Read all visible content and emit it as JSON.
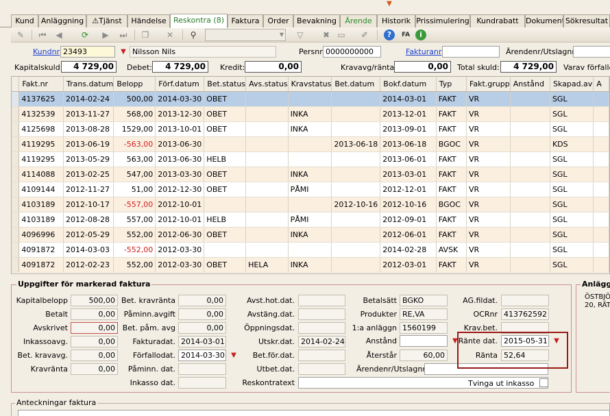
{
  "tabs": [
    "Kund",
    "Anläggning",
    "Tjänst",
    "Händelse",
    "Reskontra (8)",
    "Faktura",
    "Order",
    "Bevakning",
    "Ärende",
    "Historik",
    "Prissimulering",
    "Kundrabatt",
    "Dokument",
    "Sökresultat"
  ],
  "header": {
    "kundnr_label": "Kundnr",
    "kundnr": "23493",
    "name": "Nilsson Nils",
    "persnr_label": "Persnr",
    "persnr": "0000000000",
    "fakturanr_label": "Fakturanr",
    "fakturanr": "",
    "arendenr_label": "Ärendenr/Utslagnr",
    "arendenr": ""
  },
  "summary": {
    "kapitalskuld_label": "Kapitalskuld:",
    "kapitalskuld": "4 729,00",
    "debet_label": "Debet:",
    "debet": "4 729,00",
    "kredit_label": "Kredit:",
    "kredit": "0,00",
    "kravavg_label": "Kravavg/ränta:",
    "kravavg": "0,00",
    "total_label": "Total skuld:",
    "total": "4 729,00",
    "varav_label": "Varav förfalle"
  },
  "table": {
    "columns": [
      "Fakt.nr",
      "Trans.datum",
      "Belopp",
      "Förf.datum",
      "Bet.status",
      "Avs.status",
      "Kravstatus",
      "Bet.datum",
      "Bokf.datum",
      "Typ",
      "Fakt.grupp",
      "Anstånd",
      "Skapad.av",
      "A"
    ],
    "rows": [
      [
        "4137625",
        "2014-02-24",
        "500,00",
        "2014-03-30",
        "OBET",
        "",
        "",
        "",
        "2014-03-01",
        "FAKT",
        "VR",
        "",
        "SGL",
        ""
      ],
      [
        "4132539",
        "2013-11-27",
        "568,00",
        "2013-12-30",
        "OBET",
        "",
        "INKA",
        "",
        "2013-12-01",
        "FAKT",
        "VR",
        "",
        "SGL",
        ""
      ],
      [
        "4125698",
        "2013-08-28",
        "1529,00",
        "2013-10-01",
        "OBET",
        "",
        "INKA",
        "",
        "2013-09-01",
        "FAKT",
        "VR",
        "",
        "SGL",
        ""
      ],
      [
        "4119295",
        "2013-06-19",
        "-563,00",
        "2013-06-30",
        "",
        "",
        "",
        "2013-06-18",
        "2013-06-18",
        "BGOC",
        "VR",
        "",
        "KDS",
        ""
      ],
      [
        "4119295",
        "2013-05-29",
        "563,00",
        "2013-06-30",
        "HELB",
        "",
        "",
        "",
        "2013-06-01",
        "FAKT",
        "VR",
        "",
        "SGL",
        ""
      ],
      [
        "4114088",
        "2013-02-25",
        "547,00",
        "2013-03-30",
        "OBET",
        "",
        "INKA",
        "",
        "2013-03-01",
        "FAKT",
        "VR",
        "",
        "SGL",
        ""
      ],
      [
        "4109144",
        "2012-11-27",
        "51,00",
        "2012-12-30",
        "OBET",
        "",
        "PÅMI",
        "",
        "2012-12-01",
        "FAKT",
        "VR",
        "",
        "SGL",
        ""
      ],
      [
        "4103189",
        "2012-10-17",
        "-557,00",
        "2012-10-01",
        "",
        "",
        "",
        "2012-10-16",
        "2012-10-16",
        "BGOC",
        "VR",
        "",
        "SGL",
        ""
      ],
      [
        "4103189",
        "2012-08-28",
        "557,00",
        "2012-10-01",
        "HELB",
        "",
        "PÅMI",
        "",
        "2012-09-01",
        "FAKT",
        "VR",
        "",
        "SGL",
        ""
      ],
      [
        "4096996",
        "2012-05-29",
        "552,00",
        "2012-06-30",
        "OBET",
        "",
        "INKA",
        "",
        "2012-06-01",
        "FAKT",
        "VR",
        "",
        "SGL",
        ""
      ],
      [
        "4091872",
        "2014-03-03",
        "-552,00",
        "2012-03-30",
        "",
        "",
        "",
        "",
        "2014-02-28",
        "AVSK",
        "VR",
        "",
        "SGL",
        ""
      ],
      [
        "4091872",
        "2012-02-23",
        "552,00",
        "2012-03-30",
        "OBET",
        "HELA",
        "INKA",
        "",
        "2012-03-01",
        "FAKT",
        "VR",
        "",
        "SGL",
        ""
      ]
    ]
  },
  "details": {
    "title": "Uppgifter för markerad faktura",
    "kapitalbelopp_label": "Kapitalbelopp",
    "kapitalbelopp": "500,00",
    "betalt_label": "Betalt",
    "betalt": "0,00",
    "avskrivet_label": "Avskrivet",
    "avskrivet": "0,00",
    "inkassoavg_label": "Inkassoavg.",
    "inkassoavg": "0,00",
    "betkravavg_label": "Bet. kravavg.",
    "betkravavg": "0,00",
    "kravranta_label": "Kravränta",
    "kravranta": "0,00",
    "betkravranta_label": "Bet. kravränta",
    "betkravranta": "0,00",
    "paminnavgift_label": "Påminn.avgift",
    "paminnavgift": "0,00",
    "betpamavg_label": "Bet. påm. avg",
    "betpamavg": "0,00",
    "fakturadat_label": "Fakturadat.",
    "fakturadat": "2014-03-01",
    "forfallodat_label": "Förfallodat.",
    "forfallodat": "2014-03-30",
    "paminndat_label": "Påminn. dat.",
    "paminndat": "",
    "inkassodat_label": "Inkasso dat.",
    "inkassodat": "",
    "avsthotdat_label": "Avst.hot.dat.",
    "avsthotdat": "",
    "avstangdat_label": "Avstäng.dat.",
    "avstangdat": "",
    "oppningsdat_label": "Öppningsdat.",
    "oppningsdat": "",
    "utskrdat_label": "Utskr.dat.",
    "utskrdat": "2014-02-24",
    "betfordat_label": "Bet.för.dat.",
    "betfordat": "",
    "utbetdat_label": "Utbet.dat.",
    "utbetdat": "",
    "reskontratext_label": "Reskontratext",
    "reskontratext": "",
    "betalsatt_label": "Betalsätt",
    "betalsatt": "BGKO",
    "produkter_label": "Produkter",
    "produkter": "RE,VA",
    "anlaggn_label": "1:a anläggn",
    "anlaggn": "1560199",
    "anstand_label": "Anstånd",
    "anstand": "",
    "aterstar_label": "Återstår",
    "aterstar": "60,00",
    "arendenr_label": "Ärendenr/Utslagnr",
    "arendenr": "",
    "agfildat_label": "AG.fildat.",
    "agfildat": "",
    "ocrnr_label": "OCRnr",
    "ocrnr": "413762592",
    "kravbet_label": "Krav.bet.",
    "kravbet": "",
    "rantedat_label": "Ränte dat.",
    "rantedat": "2015-05-31",
    "ranta_label": "Ränta",
    "ranta": "52,64",
    "tvinga_label": "Tvinga ut inkasso"
  },
  "anlaggning": {
    "title": "Anlägg",
    "line1": "ÖSTBJÖ",
    "line2": "20, RÄT"
  },
  "notes": {
    "title": "Anteckningar faktura"
  },
  "colors": {
    "active_tab_text": "#2a7a2a",
    "selected_row": "#b8cde6",
    "odd_row": "#fbefe0",
    "negative": "#d02020",
    "highlight_box": "#9a1818",
    "link": "#1a3fd0"
  }
}
